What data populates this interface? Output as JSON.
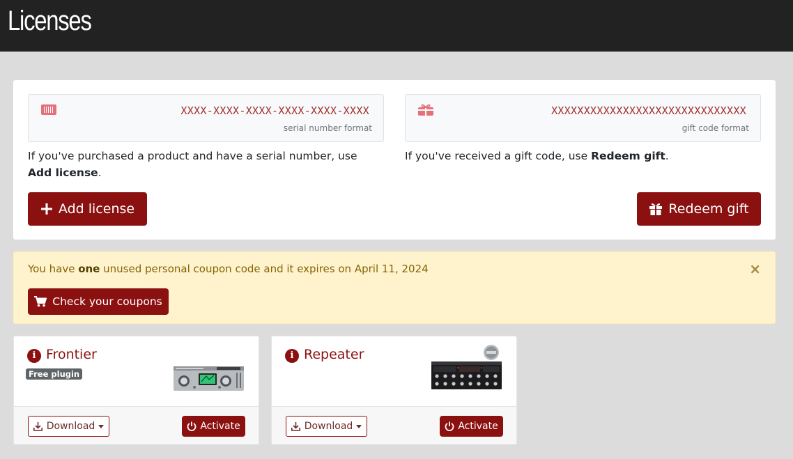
{
  "header": {
    "title": "Licenses"
  },
  "serial": {
    "format": "XXXX-XXXX-XXXX-XXXX-XXXX-XXXX",
    "caption": "serial number format",
    "help_prefix": "If you've purchased a product and have a serial number, use ",
    "help_bold": "Add license",
    "help_suffix": ".",
    "button_label": "Add license"
  },
  "gift": {
    "format": "XXXXXXXXXXXXXXXXXXXXXXXXXXXXXX",
    "caption": "gift code format",
    "help_prefix": "If you've received a gift code, use ",
    "help_bold": "Redeem gift",
    "help_suffix": ".",
    "button_label": "Redeem gift"
  },
  "coupon": {
    "text_prefix": "You have ",
    "text_bold": "one",
    "text_suffix": " unused personal coupon code and it expires on April 11, 2024",
    "close_label": "×",
    "button_label": "Check your coupons"
  },
  "products": [
    {
      "name": "Frontier",
      "badge": "Free plugin",
      "download_label": "Download",
      "activate_label": "Activate"
    },
    {
      "name": "Repeater",
      "badge": "",
      "download_label": "Download",
      "activate_label": "Activate"
    }
  ],
  "colors": {
    "accent": "#8b1111",
    "header_bg": "#222222",
    "alert_bg": "#fff3cd",
    "page_bg": "#dcdcdc"
  },
  "icons": {
    "serial": "barcode-icon",
    "gift": "gift-icon",
    "add": "plus-icon",
    "cart": "cart-icon",
    "info": "info-icon",
    "download": "download-icon",
    "power": "power-icon",
    "close": "close-icon"
  }
}
